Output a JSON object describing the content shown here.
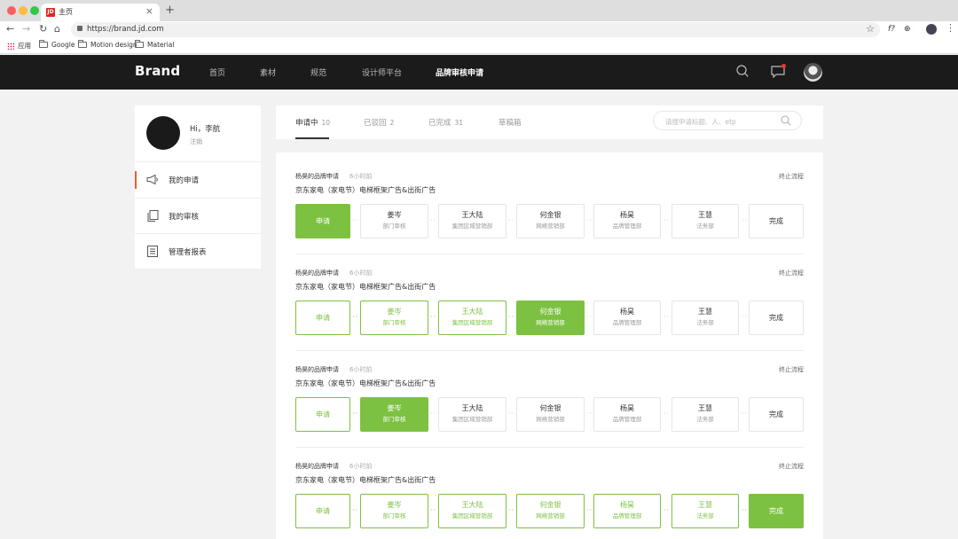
{
  "browser": {
    "tab_title": "主页",
    "tab_favicon": "JD",
    "url": "https://brand.jd.com",
    "bookmarks": [
      {
        "label": "应用",
        "icon": "apps-grid-icon"
      },
      {
        "label": "Google",
        "icon": "folder-icon"
      },
      {
        "label": "Motion design",
        "icon": "folder-icon"
      },
      {
        "label": "Material",
        "icon": "folder-icon"
      }
    ],
    "extensions": [
      "f?",
      "⊕"
    ]
  },
  "header": {
    "logo": "Brand",
    "nav": [
      "首页",
      "素材",
      "规范",
      "设计师平台",
      "品牌审核申请"
    ],
    "active_nav": "品牌审核申请"
  },
  "sidebar": {
    "greeting": "Hi，李航",
    "logout": "注销",
    "items": [
      {
        "label": "我的申请",
        "icon": "megaphone-icon",
        "active": true
      },
      {
        "label": "我的审核",
        "icon": "copy-icon",
        "active": false
      },
      {
        "label": "管理者报表",
        "icon": "list-icon",
        "active": false
      }
    ],
    "accent": "#e3632f"
  },
  "filters": {
    "tabs": [
      {
        "label": "申请中",
        "count": "10"
      },
      {
        "label": "已驳回",
        "count": "2"
      },
      {
        "label": "已完成",
        "count": "31"
      },
      {
        "label": "草稿箱",
        "count": ""
      }
    ],
    "search_placeholder": "请搜申请标题、人、etp"
  },
  "colors": {
    "green": "#7dc142",
    "header_bg": "#1b1b1b"
  },
  "requests": [
    {
      "owner": "杨昊的品牌申请",
      "time": "6小时前",
      "stop": "终止流程",
      "title": "京东家电（家电节）电梯框架广告&出街广告",
      "steps": [
        {
          "name": "申请",
          "dept": "",
          "state": "cur"
        },
        {
          "name": "姜岑",
          "dept": "部门审核",
          "state": "todo"
        },
        {
          "name": "王大陆",
          "dept": "集团区域营销部",
          "state": "todo"
        },
        {
          "name": "何金银",
          "dept": "网络营销部",
          "state": "todo"
        },
        {
          "name": "杨昊",
          "dept": "品牌管理部",
          "state": "todo"
        },
        {
          "name": "王慧",
          "dept": "法务部",
          "state": "todo"
        },
        {
          "name": "完成",
          "dept": "",
          "state": "todo"
        }
      ]
    },
    {
      "owner": "杨昊的品牌申请",
      "time": "6小时前",
      "stop": "终止流程",
      "title": "京东家电（家电节）电梯框架广告&出街广告",
      "steps": [
        {
          "name": "申请",
          "dept": "",
          "state": "done"
        },
        {
          "name": "姜岑",
          "dept": "部门审核",
          "state": "done"
        },
        {
          "name": "王大陆",
          "dept": "集团区域营销部",
          "state": "done"
        },
        {
          "name": "何金银",
          "dept": "网络营销部",
          "state": "cur"
        },
        {
          "name": "杨昊",
          "dept": "品牌管理部",
          "state": "todo"
        },
        {
          "name": "王慧",
          "dept": "法务部",
          "state": "todo"
        },
        {
          "name": "完成",
          "dept": "",
          "state": "todo"
        }
      ]
    },
    {
      "owner": "杨昊的品牌申请",
      "time": "6小时前",
      "stop": "终止流程",
      "title": "京东家电（家电节）电梯框架广告&出街广告",
      "steps": [
        {
          "name": "申请",
          "dept": "",
          "state": "done"
        },
        {
          "name": "姜岑",
          "dept": "部门审核",
          "state": "cur"
        },
        {
          "name": "王大陆",
          "dept": "集团区域营销部",
          "state": "todo"
        },
        {
          "name": "何金银",
          "dept": "网络营销部",
          "state": "todo"
        },
        {
          "name": "杨昊",
          "dept": "品牌管理部",
          "state": "todo"
        },
        {
          "name": "王慧",
          "dept": "法务部",
          "state": "todo"
        },
        {
          "name": "完成",
          "dept": "",
          "state": "todo"
        }
      ]
    },
    {
      "owner": "杨昊的品牌申请",
      "time": "6小时前",
      "stop": "终止流程",
      "title": "京东家电（家电节）电梯框架广告&出街广告",
      "steps": [
        {
          "name": "申请",
          "dept": "",
          "state": "done"
        },
        {
          "name": "姜岑",
          "dept": "部门审核",
          "state": "done"
        },
        {
          "name": "王大陆",
          "dept": "集团区域营销部",
          "state": "done"
        },
        {
          "name": "何金银",
          "dept": "网络营销部",
          "state": "done"
        },
        {
          "name": "杨昊",
          "dept": "品牌管理部",
          "state": "done"
        },
        {
          "name": "王慧",
          "dept": "法务部",
          "state": "done"
        },
        {
          "name": "完成",
          "dept": "",
          "state": "cur"
        }
      ]
    }
  ]
}
